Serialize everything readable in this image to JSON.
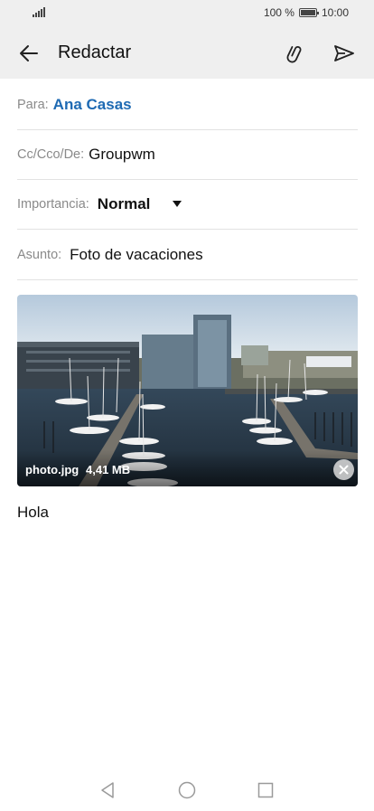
{
  "status_bar": {
    "battery_text": "100 %",
    "time": "10:00"
  },
  "app_bar": {
    "title": "Redactar",
    "icons": [
      "back-arrow-icon",
      "paperclip-icon",
      "send-icon"
    ]
  },
  "form": {
    "to": {
      "label": "Para:",
      "value": "Ana Casas"
    },
    "cc": {
      "label": "Cc/Cco/De:",
      "value": "Groupwm"
    },
    "importance": {
      "label": "Importancia:",
      "value": "Normal"
    },
    "subject": {
      "label": "Asunto:",
      "value": "Foto de vacaciones"
    }
  },
  "attachment": {
    "file_name": "photo.jpg",
    "file_size": "4,41 MB"
  },
  "body": {
    "text": "Hola"
  },
  "colors": {
    "accent": "#1e6ab3",
    "app_bar_bg": "#efefef"
  },
  "nav_bar": {
    "icons": [
      "nav-back-icon",
      "nav-home-icon",
      "nav-recent-icon"
    ]
  }
}
